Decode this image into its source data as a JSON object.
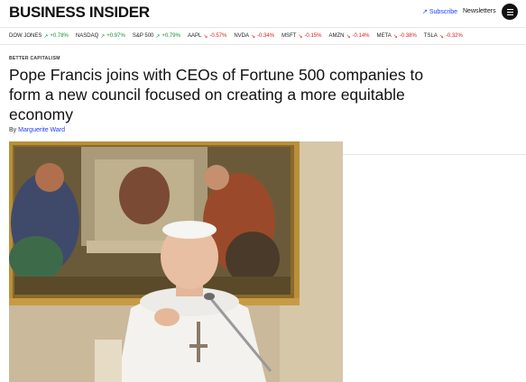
{
  "header": {
    "logo": "BUSINESS INSIDER",
    "subscribe_label": "Subscribe",
    "newsletters_label": "Newsletters"
  },
  "ticker": [
    {
      "symbol": "DOW JONES",
      "change": "+0.78%",
      "dir": "up"
    },
    {
      "symbol": "NASDAQ",
      "change": "+0.97%",
      "dir": "up"
    },
    {
      "symbol": "S&P 500",
      "change": "+0.79%",
      "dir": "up"
    },
    {
      "symbol": "AAPL",
      "change": "-0.57%",
      "dir": "down"
    },
    {
      "symbol": "NVDA",
      "change": "-0.34%",
      "dir": "down"
    },
    {
      "symbol": "MSFT",
      "change": "-0.15%",
      "dir": "down"
    },
    {
      "symbol": "AMZN",
      "change": "-0.14%",
      "dir": "down"
    },
    {
      "symbol": "META",
      "change": "-0.38%",
      "dir": "down"
    },
    {
      "symbol": "TSLA",
      "change": "-0.32%",
      "dir": "down"
    }
  ],
  "article": {
    "kicker": "BETTER CAPITALISM",
    "headline": "Pope Francis joins with CEOs of Fortune 500 companies to form a new council focused on creating a more equitable economy",
    "byline_prefix": "By",
    "author": "Marguerite Ward"
  },
  "colors": {
    "accent": "#1a3cff",
    "up": "#1a8a3a",
    "down": "#d32020"
  }
}
